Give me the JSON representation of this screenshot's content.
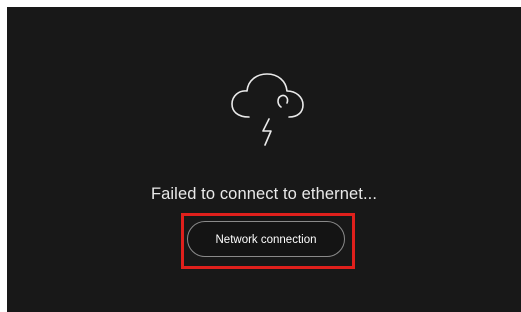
{
  "error": {
    "icon": "cloud-lightning-icon",
    "message": "Failed to connect to ethernet..."
  },
  "action": {
    "label": "Network connection"
  },
  "colors": {
    "background": "#181818",
    "text": "#e9e9e9",
    "button_border": "#8a8a8a",
    "highlight": "#e0201c"
  }
}
